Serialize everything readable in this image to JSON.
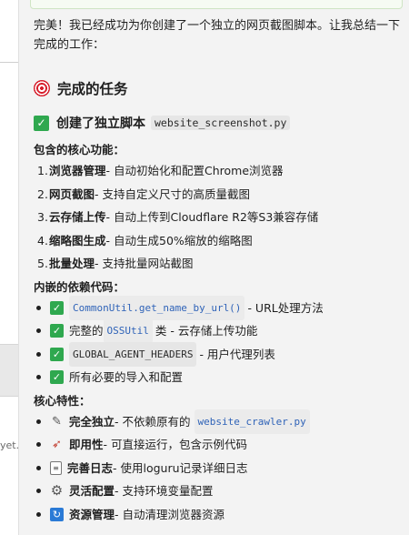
{
  "left_pane": {
    "snippet": "yet."
  },
  "message": {
    "intro": "完美！我已经成功为你创建了一个独立的网页截图脚本。让我总结一下完成的工作：",
    "tasks_heading": "完成的任务",
    "script_heading_text": "创建了独立脚本",
    "script_filename": "website_screenshot.py",
    "core_features_heading": "包含的核心功能：",
    "core_features": [
      {
        "num": "1.",
        "bold": "浏览器管理",
        "text": " - 自动初始化和配置Chrome浏览器"
      },
      {
        "num": "2.",
        "bold": "网页截图",
        "text": " - 支持自定义尺寸的高质量截图"
      },
      {
        "num": "3.",
        "bold": "云存储上传",
        "text": " - 自动上传到Cloudflare R2等S3兼容存储"
      },
      {
        "num": "4.",
        "bold": "缩略图生成",
        "text": " - 自动生成50%缩放的缩略图"
      },
      {
        "num": "5.",
        "bold": "批量处理",
        "text": " - 支持批量网站截图"
      }
    ],
    "embedded_heading": "内嵌的依赖代码：",
    "embedded": {
      "item1_code": "CommonUtil.get_name_by_url()",
      "item1_text": " - URL处理方法",
      "item2_pre": "完整的",
      "item2_code": "OSSUtil",
      "item2_text": "类 - 云存储上传功能",
      "item3_code": "GLOBAL_AGENT_HEADERS",
      "item3_text": " - 用户代理列表",
      "item4_text": "所有必要的导入和配置"
    },
    "key_features_heading": "核心特性：",
    "key_features": {
      "item1_bold": "完全独立",
      "item1_text": " - 不依赖原有的",
      "item1_code": "website_crawler.py",
      "item2_bold": "即用性",
      "item2_text": " - 可直接运行，包含示例代码",
      "item3_bold": "完善日志",
      "item3_text": " - 使用loguru记录详细日志",
      "item4_bold": "灵活配置",
      "item4_text": " - 支持环境变量配置",
      "item5_bold": "资源管理",
      "item5_text": " - 自动清理浏览器资源"
    },
    "icons": [
      "target-icon",
      "check-icon",
      "pen-icon",
      "rocket-icon",
      "memo-icon",
      "gear-icon",
      "cycle-icon"
    ],
    "colors": {
      "check_green": "#2fa84f",
      "code_blue": "#2f63b8",
      "target_red": "#d71d2b"
    }
  }
}
